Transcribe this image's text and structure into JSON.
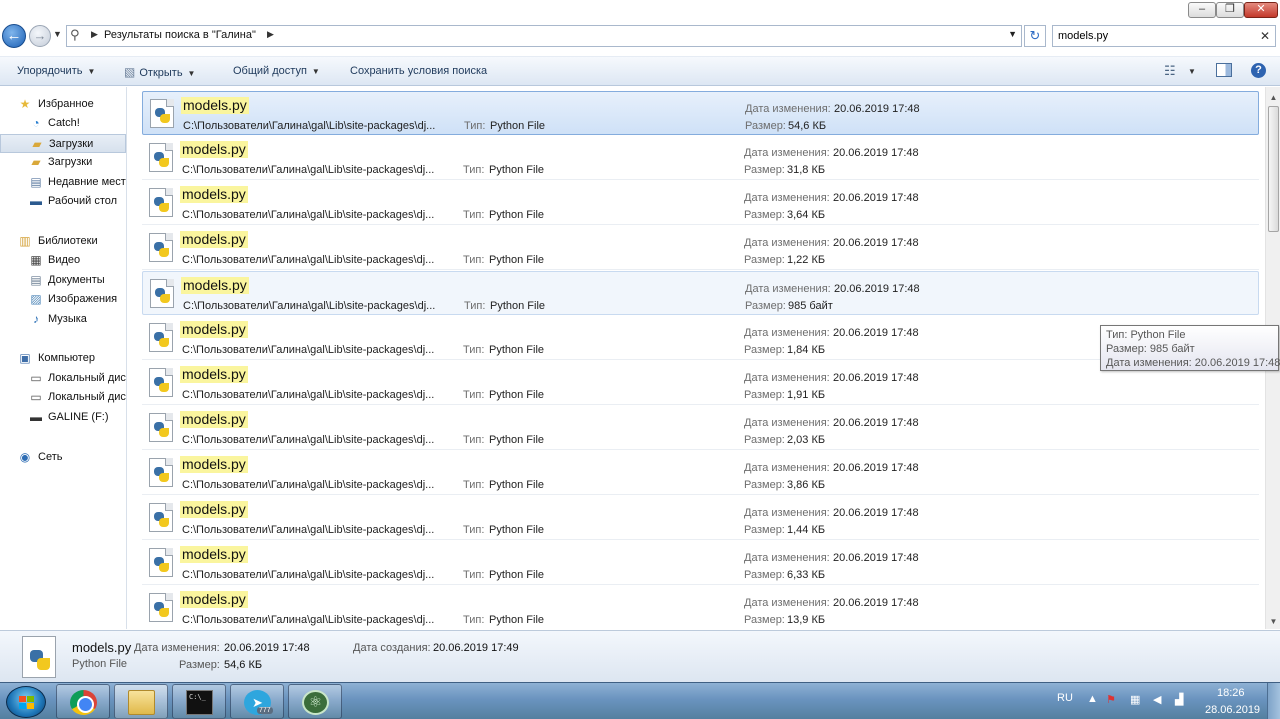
{
  "window": {
    "min_label": "–",
    "max_label": "❐",
    "close_label": "✕"
  },
  "address": {
    "back_label": "←",
    "forward_label": "→",
    "path_text": "Результаты поиска в \"Галина\"",
    "refresh_label": "↻"
  },
  "search": {
    "query": "models.py",
    "clear_label": "✕"
  },
  "toolbar": {
    "organize": "Упорядочить",
    "open": "Открыть",
    "share": "Общий доступ",
    "save_search": "Сохранить условия поиска",
    "help": "?"
  },
  "sidebar": {
    "items": [
      {
        "label": "Избранное",
        "icon": "star-icon",
        "glyph": "★",
        "color": "#e7b93a",
        "level": "group"
      },
      {
        "label": "Catch!",
        "icon": "catch-icon",
        "glyph": "◔",
        "color": "#2a7fd0",
        "level": "child"
      },
      {
        "label": "Загрузки",
        "icon": "downloads-folder-icon",
        "glyph": "▰",
        "color": "#d9a83a",
        "level": "child",
        "selected": true
      },
      {
        "label": "Загрузки",
        "icon": "downloads-folder-icon",
        "glyph": "▰",
        "color": "#d9a83a",
        "level": "child"
      },
      {
        "label": "Недавние мест",
        "icon": "recent-places-icon",
        "glyph": "▤",
        "color": "#5b7aa0",
        "level": "child"
      },
      {
        "label": "Рабочий стол",
        "icon": "desktop-icon",
        "glyph": "▬",
        "color": "#2b5a8f",
        "level": "child"
      },
      {
        "label": "Библиотеки",
        "icon": "libraries-icon",
        "glyph": "▥",
        "color": "#d4a23b",
        "level": "group"
      },
      {
        "label": "Видео",
        "icon": "video-icon",
        "glyph": "▦",
        "color": "#444",
        "level": "child"
      },
      {
        "label": "Документы",
        "icon": "documents-icon",
        "glyph": "▤",
        "color": "#6a7d92",
        "level": "child"
      },
      {
        "label": "Изображения",
        "icon": "pictures-icon",
        "glyph": "▨",
        "color": "#4d86b8",
        "level": "child"
      },
      {
        "label": "Музыка",
        "icon": "music-icon",
        "glyph": "♪",
        "color": "#2a6fb6",
        "level": "child"
      },
      {
        "label": "Компьютер",
        "icon": "computer-icon",
        "glyph": "▣",
        "color": "#3f6ea8",
        "level": "group"
      },
      {
        "label": "Локальный дис",
        "icon": "local-disk-icon",
        "glyph": "▭",
        "color": "#555",
        "level": "child"
      },
      {
        "label": "Локальный дис",
        "icon": "local-disk-icon",
        "glyph": "▭",
        "color": "#555",
        "level": "child"
      },
      {
        "label": "GALINE (F:)",
        "icon": "usb-drive-icon",
        "glyph": "▬",
        "color": "#333",
        "level": "child"
      },
      {
        "label": "Сеть",
        "icon": "network-icon",
        "glyph": "◉",
        "color": "#2e6db4",
        "level": "group"
      }
    ]
  },
  "results_labels": {
    "type": "Тип:",
    "date": "Дата изменения:",
    "size": "Размер:"
  },
  "results": [
    {
      "name": "models.py",
      "path": "C:\\Пользователи\\Галина\\gal\\Lib\\site-packages\\dj...",
      "type": "Python File",
      "date": "20.06.2019 17:48",
      "size": "54,6 КБ",
      "state": "selected"
    },
    {
      "name": "models.py",
      "path": "C:\\Пользователи\\Галина\\gal\\Lib\\site-packages\\dj...",
      "type": "Python File",
      "date": "20.06.2019 17:48",
      "size": "31,8 КБ",
      "state": ""
    },
    {
      "name": "models.py",
      "path": "C:\\Пользователи\\Галина\\gal\\Lib\\site-packages\\dj...",
      "type": "Python File",
      "date": "20.06.2019 17:48",
      "size": "3,64 КБ",
      "state": ""
    },
    {
      "name": "models.py",
      "path": "C:\\Пользователи\\Галина\\gal\\Lib\\site-packages\\dj...",
      "type": "Python File",
      "date": "20.06.2019 17:48",
      "size": "1,22 КБ",
      "state": ""
    },
    {
      "name": "models.py",
      "path": "C:\\Пользователи\\Галина\\gal\\Lib\\site-packages\\dj...",
      "type": "Python File",
      "date": "20.06.2019 17:48",
      "size": "985 байт",
      "state": "hover"
    },
    {
      "name": "models.py",
      "path": "C:\\Пользователи\\Галина\\gal\\Lib\\site-packages\\dj...",
      "type": "Python File",
      "date": "20.06.2019 17:48",
      "size": "1,84 КБ",
      "state": ""
    },
    {
      "name": "models.py",
      "path": "C:\\Пользователи\\Галина\\gal\\Lib\\site-packages\\dj...",
      "type": "Python File",
      "date": "20.06.2019 17:48",
      "size": "1,91 КБ",
      "state": ""
    },
    {
      "name": "models.py",
      "path": "C:\\Пользователи\\Галина\\gal\\Lib\\site-packages\\dj...",
      "type": "Python File",
      "date": "20.06.2019 17:48",
      "size": "2,03 КБ",
      "state": ""
    },
    {
      "name": "models.py",
      "path": "C:\\Пользователи\\Галина\\gal\\Lib\\site-packages\\dj...",
      "type": "Python File",
      "date": "20.06.2019 17:48",
      "size": "3,86 КБ",
      "state": ""
    },
    {
      "name": "models.py",
      "path": "C:\\Пользователи\\Галина\\gal\\Lib\\site-packages\\dj...",
      "type": "Python File",
      "date": "20.06.2019 17:48",
      "size": "1,44 КБ",
      "state": ""
    },
    {
      "name": "models.py",
      "path": "C:\\Пользователи\\Галина\\gal\\Lib\\site-packages\\dj...",
      "type": "Python File",
      "date": "20.06.2019 17:48",
      "size": "6,33 КБ",
      "state": ""
    },
    {
      "name": "models.py",
      "path": "C:\\Пользователи\\Галина\\gal\\Lib\\site-packages\\dj...",
      "type": "Python File",
      "date": "20.06.2019 17:48",
      "size": "13,9 КБ",
      "state": ""
    }
  ],
  "tooltip": {
    "type_line": "Тип: Python File",
    "size_line": "Размер: 985 байт",
    "date_line": "Дата изменения: 20.06.2019 17:48"
  },
  "details": {
    "name": "models.py",
    "type": "Python File",
    "modified_label": "Дата изменения:",
    "modified_value": "20.06.2019 17:48",
    "created_label": "Дата создания:",
    "created_value": "20.06.2019 17:49",
    "size_label": "Размер:",
    "size_value": "54,6 КБ"
  },
  "taskbar": {
    "apps": [
      {
        "name": "taskbar-chrome",
        "icon": "chrome-icon",
        "kind": "chrome"
      },
      {
        "name": "taskbar-explorer",
        "icon": "explorer-folder-icon",
        "kind": "folder",
        "active": true
      },
      {
        "name": "taskbar-cmd",
        "icon": "cmd-icon",
        "kind": "cmd"
      },
      {
        "name": "taskbar-telegram",
        "icon": "telegram-icon",
        "kind": "tg",
        "badge": "777"
      },
      {
        "name": "taskbar-atom",
        "icon": "atom-icon",
        "kind": "atom"
      }
    ],
    "cmd_text": "C:\\_",
    "lang": "RU",
    "time": "18:26",
    "date": "28.06.2019"
  },
  "colors": {
    "accent": "#2e63b0",
    "highlight": "#faf59e",
    "selection": "#cfe1f7"
  }
}
